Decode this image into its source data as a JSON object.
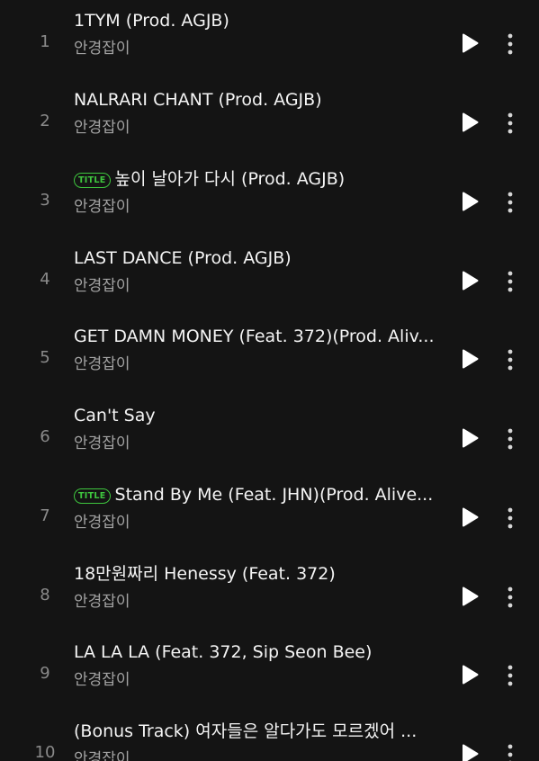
{
  "tracks": [
    {
      "number": "1",
      "title": "1TYM (Prod. AGJB)",
      "artist": "안경잡이",
      "badge": ""
    },
    {
      "number": "2",
      "title": "NALRARI CHANT (Prod. AGJB)",
      "artist": "안경잡이",
      "badge": ""
    },
    {
      "number": "3",
      "title": "높이 날아가 다시 (Prod. AGJB)",
      "artist": "안경잡이",
      "badge": "TITLE"
    },
    {
      "number": "4",
      "title": "LAST DANCE (Prod. AGJB)",
      "artist": "안경잡이",
      "badge": ""
    },
    {
      "number": "5",
      "title": "GET DAMN MONEY (Feat. 372)(Prod. Aliv...",
      "artist": "안경잡이",
      "badge": ""
    },
    {
      "number": "6",
      "title": "Can't Say",
      "artist": "안경잡이",
      "badge": ""
    },
    {
      "number": "7",
      "title": "Stand By Me (Feat. JHN)(Prod. Alive...",
      "artist": "안경잡이",
      "badge": "TITLE"
    },
    {
      "number": "8",
      "title": "18만원짜리 Henessy (Feat. 372)",
      "artist": "안경잡이",
      "badge": ""
    },
    {
      "number": "9",
      "title": "LA LA LA (Feat. 372, Sip Seon Bee)",
      "artist": "안경잡이",
      "badge": ""
    },
    {
      "number": "10",
      "title": "(Bonus Track) 여자들은 알다가도 모르겠어 ...",
      "artist": "안경잡이",
      "badge": ""
    }
  ],
  "icons": {
    "play": "play-icon",
    "more": "more-vertical-icon"
  },
  "colors": {
    "background": "#141414",
    "title_text": "#f4f4f4",
    "artist_text": "#a3a3a3",
    "track_number": "#8a8a8a",
    "badge_accent": "#3ec63e"
  }
}
